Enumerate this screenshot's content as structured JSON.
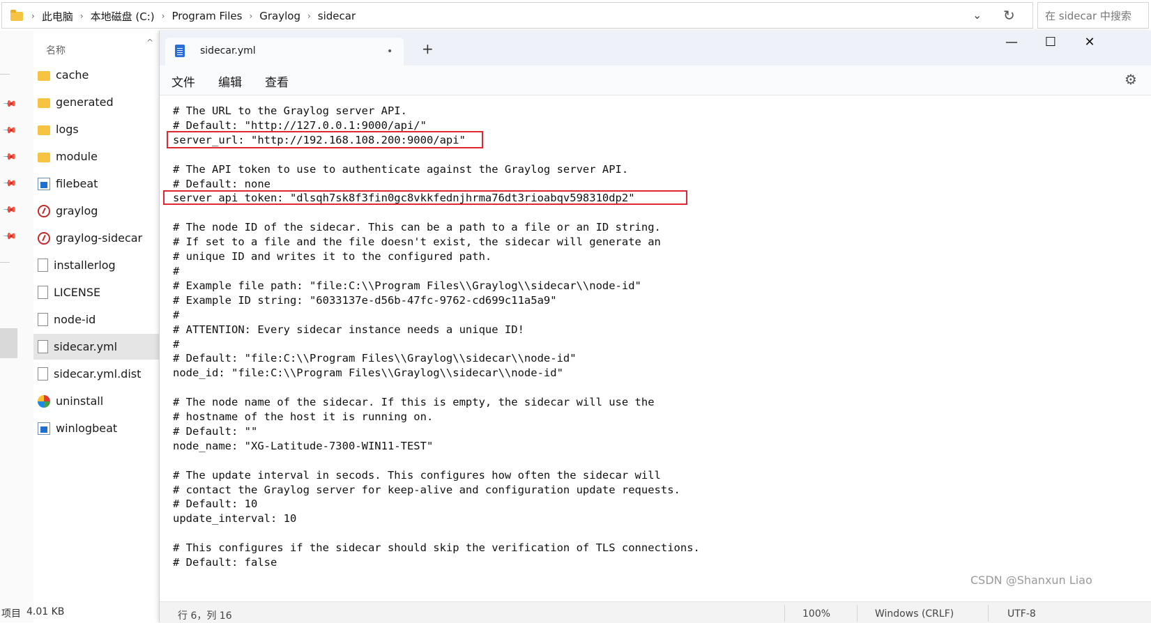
{
  "explorer": {
    "breadcrumb": [
      "此电脑",
      "本地磁盘 (C:)",
      "Program Files",
      "Graylog",
      "sidecar"
    ],
    "search_placeholder": "在 sidecar 中搜索",
    "column_name": "名称",
    "files": [
      {
        "name": "cache",
        "icon": "folder-icon"
      },
      {
        "name": "generated",
        "icon": "folder-icon"
      },
      {
        "name": "logs",
        "icon": "folder-icon"
      },
      {
        "name": "module",
        "icon": "folder-icon"
      },
      {
        "name": "filebeat",
        "icon": "app-icon"
      },
      {
        "name": "graylog",
        "icon": "graylog-icon"
      },
      {
        "name": "graylog-sidecar",
        "icon": "graylog-icon"
      },
      {
        "name": "installerlog",
        "icon": "document-icon"
      },
      {
        "name": "LICENSE",
        "icon": "document-icon"
      },
      {
        "name": "node-id",
        "icon": "document-icon"
      },
      {
        "name": "sidecar.yml",
        "icon": "document-icon",
        "selected": true
      },
      {
        "name": "sidecar.yml.dist",
        "icon": "document-icon"
      },
      {
        "name": "uninstall",
        "icon": "uninstall-icon"
      },
      {
        "name": "winlogbeat",
        "icon": "app-icon"
      }
    ],
    "status_item_label": "项目",
    "status_size": "4.01 KB"
  },
  "notepad": {
    "tab_title": "sidecar.yml",
    "tab_modified": "•",
    "new_tab": "+",
    "window_buttons": {
      "minimize": "—",
      "maximize": "☐",
      "close": "✕"
    },
    "menu": {
      "file": "文件",
      "edit": "编辑",
      "view": "查看"
    },
    "content": "# The URL to the Graylog server API.\n# Default: \"http://127.0.0.1:9000/api/\"\nserver_url: \"http://192.168.108.200:9000/api\"\n\n# The API token to use to authenticate against the Graylog server API.\n# Default: none\nserver_api_token: \"dlsqh7sk8f3fin0gc8vkkfednjhrma76dt3rioabqv598310dp2\"\n\n# The node ID of the sidecar. This can be a path to a file or an ID string.\n# If set to a file and the file doesn't exist, the sidecar will generate an\n# unique ID and writes it to the configured path.\n#\n# Example file path: \"file:C:\\\\Program Files\\\\Graylog\\\\sidecar\\\\node-id\"\n# Example ID string: \"6033137e-d56b-47fc-9762-cd699c11a5a9\"\n#\n# ATTENTION: Every sidecar instance needs a unique ID!\n#\n# Default: \"file:C:\\\\Program Files\\\\Graylog\\\\sidecar\\\\node-id\"\nnode_id: \"file:C:\\\\Program Files\\\\Graylog\\\\sidecar\\\\node-id\"\n\n# The node name of the sidecar. If this is empty, the sidecar will use the\n# hostname of the host it is running on.\n# Default: \"\"\nnode_name: \"XG-Latitude-7300-WIN11-TEST\"\n\n# The update interval in secods. This configures how often the sidecar will\n# contact the Graylog server for keep-alive and configuration update requests.\n# Default: 10\nupdate_interval: 10\n\n# This configures if the sidecar should skip the verification of TLS connections.\n# Default: false",
    "status": {
      "position": "行 6，列 16",
      "zoom": "100%",
      "line_ending": "Windows (CRLF)",
      "encoding": "UTF-8"
    }
  },
  "watermark": "CSDN @Shanxun Liao",
  "colors": {
    "highlight_box": "#e0262e",
    "accent": "#2a6fd6"
  }
}
